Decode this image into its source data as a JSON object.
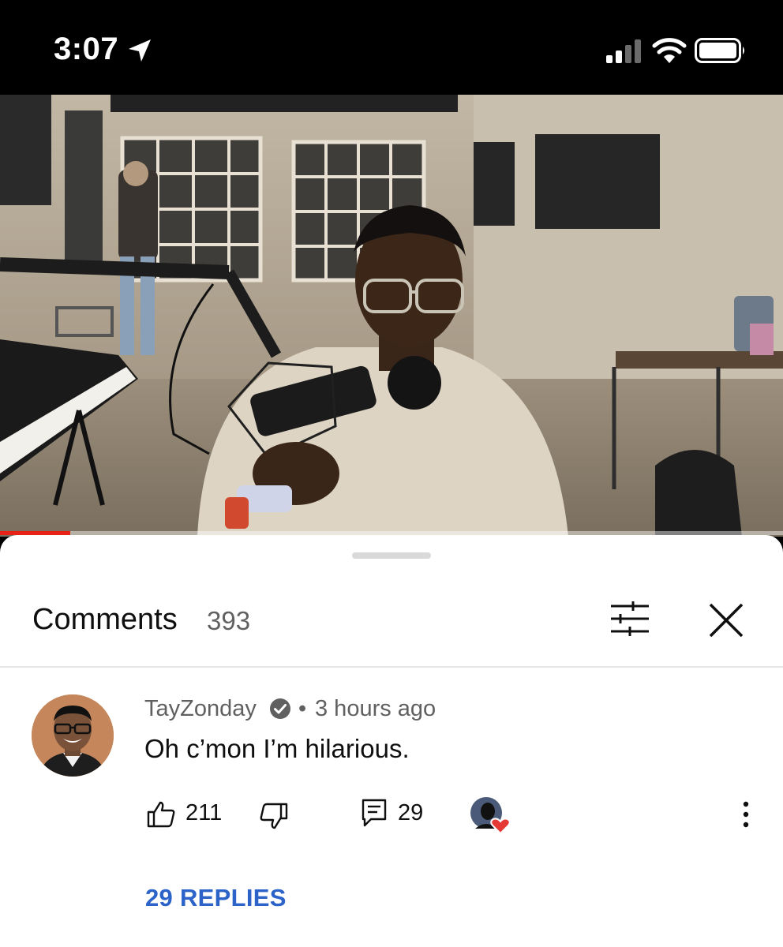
{
  "status_bar": {
    "time": "3:07",
    "icons": [
      "location-arrow-icon",
      "cellular-signal-icon",
      "wifi-icon",
      "battery-icon"
    ]
  },
  "video": {
    "progress": 0.09,
    "progress_color": "#e62117"
  },
  "comments_panel": {
    "title": "Comments",
    "count": "393",
    "icons": [
      "sort-filter-icon",
      "close-icon"
    ]
  },
  "comment": {
    "author": "TayZonday",
    "verified": true,
    "separator": "•",
    "time": "3 hours ago",
    "text": "Oh c’mon I’m hilarious.",
    "likes": "211",
    "replies_count": "29",
    "creator_hearted": true,
    "replies_label": "29 REPLIES",
    "replies_link_color": "#2b63c9"
  }
}
